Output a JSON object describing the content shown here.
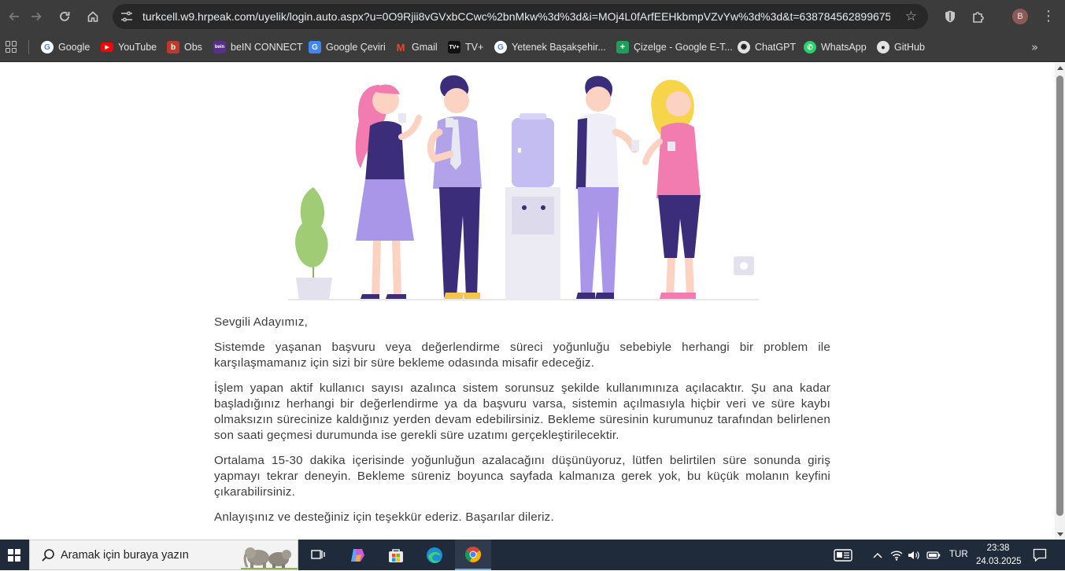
{
  "browser": {
    "url": "turkcell.w9.hrpeak.com/uyelik/login.auto.aspx?u=0O9Rjii8vGVxbCCwc%2bnMkw%3d%3d&i=MOj4L0fArfEEHkbmpVZvYw%3d%3d&t=638784562899675...",
    "profile_initial": "B",
    "colors": {
      "frame": "#3c3c3c",
      "omnibox": "#282828"
    }
  },
  "bookmarks": [
    {
      "label": "Google",
      "icon": "google-icon"
    },
    {
      "label": "YouTube",
      "icon": "youtube-icon"
    },
    {
      "label": "Obs",
      "icon": "obs-icon"
    },
    {
      "label": "beIN CONNECT",
      "icon": "bein-icon"
    },
    {
      "label": "Google Çeviri",
      "icon": "google-translate-icon"
    },
    {
      "label": "Gmail",
      "icon": "gmail-icon"
    },
    {
      "label": "TV+",
      "icon": "tvplus-icon"
    },
    {
      "label": "Yetenek Başakşehir...",
      "icon": "google-icon"
    },
    {
      "label": "Çizelge - Google E-T...",
      "icon": "google-sheets-icon"
    },
    {
      "label": "ChatGPT",
      "icon": "chatgpt-icon"
    },
    {
      "label": "WhatsApp",
      "icon": "whatsapp-icon"
    },
    {
      "label": "GitHub",
      "icon": "github-icon"
    }
  ],
  "page": {
    "greeting": "Sevgili Adayımız,",
    "paragraphs": [
      "Sistemde yaşanan başvuru veya değerlendirme süreci yoğunluğu sebebiyle herhangi bir problem ile karşılaşmamanız için sizi bir süre bekleme odasında misafir edeceğiz.",
      "İşlem yapan aktif kullanıcı sayısı azalınca sistem sorunsuz şekilde kullanımınıza açılacaktır. Şu ana kadar başladığınız herhangi bir değerlendirme ya da başvuru varsa, sistemin açılmasıyla hiçbir veri ve süre kaybı olmaksızın sürecinize kaldığınız yerden devam edebilirsiniz. Bekleme süresinin kurumunuz tarafından belirlenen son saati geçmesi durumunda ise gerekli süre uzatımı gerçekleştirilecektir.",
      "Ortalama 15-30 dakika içerisinde yoğunluğun azalacağını düşünüyoruz, lütfen belirtilen süre sonunda giriş yapmayı tekrar deneyin. Bekleme süreniz boyunca sayfada kalmanıza gerek yok, bu küçük molanın keyfini çıkarabilirsiniz.",
      "Anlayışınız ve desteğiniz için teşekkür ederiz. Başarılar dileriz."
    ]
  },
  "taskbar": {
    "search_placeholder": "Aramak için buraya yazın",
    "language": "TUR",
    "time": "23:38",
    "date": "24.03.2025",
    "apps": [
      "task-view-icon",
      "copilot-icon",
      "microsoft-store-icon",
      "edge-icon",
      "chrome-icon"
    ],
    "active_app": "chrome-icon"
  }
}
